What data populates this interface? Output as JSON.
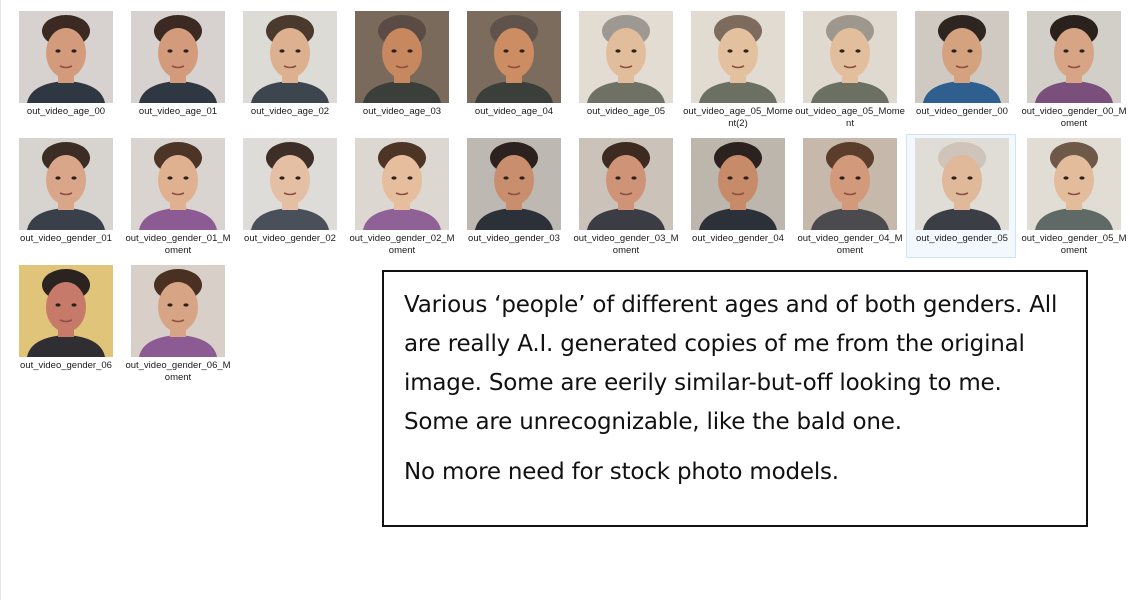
{
  "files": [
    {
      "name": "out_video_age_00",
      "icon": "portrait-thumbnail",
      "bg": "#d7d2cf",
      "skin": "#d39b7c",
      "hair": "#3a2a21",
      "shirt": "#2e3742"
    },
    {
      "name": "out_video_age_01",
      "icon": "portrait-thumbnail",
      "bg": "#d7d2cf",
      "skin": "#d39b7c",
      "hair": "#3a2a21",
      "shirt": "#2e3742"
    },
    {
      "name": "out_video_age_02",
      "icon": "portrait-thumbnail",
      "bg": "#dcdbd6",
      "skin": "#ddb08f",
      "hair": "#4a3a2e",
      "shirt": "#3d454f"
    },
    {
      "name": "out_video_age_03",
      "icon": "portrait-thumbnail",
      "bg": "#7a6a5c",
      "skin": "#c7885f",
      "hair": "#5a4c44",
      "shirt": "#3a3f3a"
    },
    {
      "name": "out_video_age_04",
      "icon": "portrait-thumbnail",
      "bg": "#7c6c5e",
      "skin": "#cc8d62",
      "hair": "#60534b",
      "shirt": "#3a3f3a"
    },
    {
      "name": "out_video_age_05",
      "icon": "portrait-thumbnail",
      "bg": "#e3dcd2",
      "skin": "#e2bd9b",
      "hair": "#9d9891",
      "shirt": "#6f7164"
    },
    {
      "name": "out_video_age_05_Moment(2)",
      "icon": "portrait-thumbnail",
      "bg": "#e1dbd1",
      "skin": "#e3c19f",
      "hair": "#7d6b5e",
      "shirt": "#6c7062"
    },
    {
      "name": "out_video_age_05_Moment",
      "icon": "portrait-thumbnail",
      "bg": "#e0d9cf",
      "skin": "#e2be9c",
      "hair": "#9e978e",
      "shirt": "#6c7062"
    },
    {
      "name": "out_video_gender_00",
      "icon": "portrait-thumbnail",
      "bg": "#cfc9c2",
      "skin": "#d4a27f",
      "hair": "#2e2420",
      "shirt": "#2f5f8e"
    },
    {
      "name": "out_video_gender_00_Moment",
      "icon": "portrait-thumbnail",
      "bg": "#d2cec8",
      "skin": "#d7a585",
      "hair": "#2a211d",
      "shirt": "#7b4f7b"
    },
    {
      "name": "out_video_gender_01",
      "icon": "portrait-thumbnail",
      "bg": "#d7d4d0",
      "skin": "#d9a689",
      "hair": "#3b2d25",
      "shirt": "#394049"
    },
    {
      "name": "out_video_gender_01_Moment",
      "icon": "portrait-thumbnail",
      "bg": "#d9d4cf",
      "skin": "#e0b190",
      "hair": "#4c3426",
      "shirt": "#8c5b93"
    },
    {
      "name": "out_video_gender_02",
      "icon": "portrait-thumbnail",
      "bg": "#dedcd8",
      "skin": "#e4bfa3",
      "hair": "#3d2f27",
      "shirt": "#4a505a"
    },
    {
      "name": "out_video_gender_02_Moment",
      "icon": "portrait-thumbnail",
      "bg": "#dcd7d1",
      "skin": "#e6bd9d",
      "hair": "#4d3526",
      "shirt": "#906196"
    },
    {
      "name": "out_video_gender_03",
      "icon": "portrait-thumbnail",
      "bg": "#bdb8b1",
      "skin": "#c98e6d",
      "hair": "#2b2220",
      "shirt": "#2c3038"
    },
    {
      "name": "out_video_gender_03_Moment",
      "icon": "portrait-thumbnail",
      "bg": "#cbc3b9",
      "skin": "#cf9478",
      "hair": "#3d2a20",
      "shirt": "#3c3c44"
    },
    {
      "name": "out_video_gender_04",
      "icon": "portrait-thumbnail",
      "bg": "#bdb6ad",
      "skin": "#c88b69",
      "hair": "#2b2220",
      "shirt": "#2c3038"
    },
    {
      "name": "out_video_gender_04_Moment",
      "icon": "portrait-thumbnail",
      "bg": "#c6b9ab",
      "skin": "#d29a7b",
      "hair": "#5a3d2b",
      "shirt": "#4a4a4f"
    },
    {
      "name": "out_video_gender_05",
      "icon": "portrait-thumbnail",
      "bg": "#e0dcd6",
      "skin": "#e0b89a",
      "hair": "#cfc4b9",
      "shirt": "#3b3f45",
      "selected": true
    },
    {
      "name": "out_video_gender_05_Moment",
      "icon": "portrait-thumbnail",
      "bg": "#e2ddd4",
      "skin": "#e2bc9b",
      "hair": "#6e5848",
      "shirt": "#5f6a66"
    },
    {
      "name": "out_video_gender_06",
      "icon": "portrait-thumbnail",
      "bg": "#e0c47a",
      "skin": "#c77a6a",
      "hair": "#2b2320",
      "shirt": "#2f2e33"
    },
    {
      "name": "out_video_gender_06_Moment",
      "icon": "portrait-thumbnail",
      "bg": "#d8d0c8",
      "skin": "#d8a486",
      "hair": "#4a3020",
      "shirt": "#8c5b93"
    }
  ],
  "caption": {
    "paragraph1": "Various ‘people’ of different ages and of both genders. All are really A.I. generated copies of me from the original image. Some are eerily similar-but-off looking to me. Some are unrecognizable, like the bald one.",
    "paragraph2": "No more need for stock photo models."
  }
}
